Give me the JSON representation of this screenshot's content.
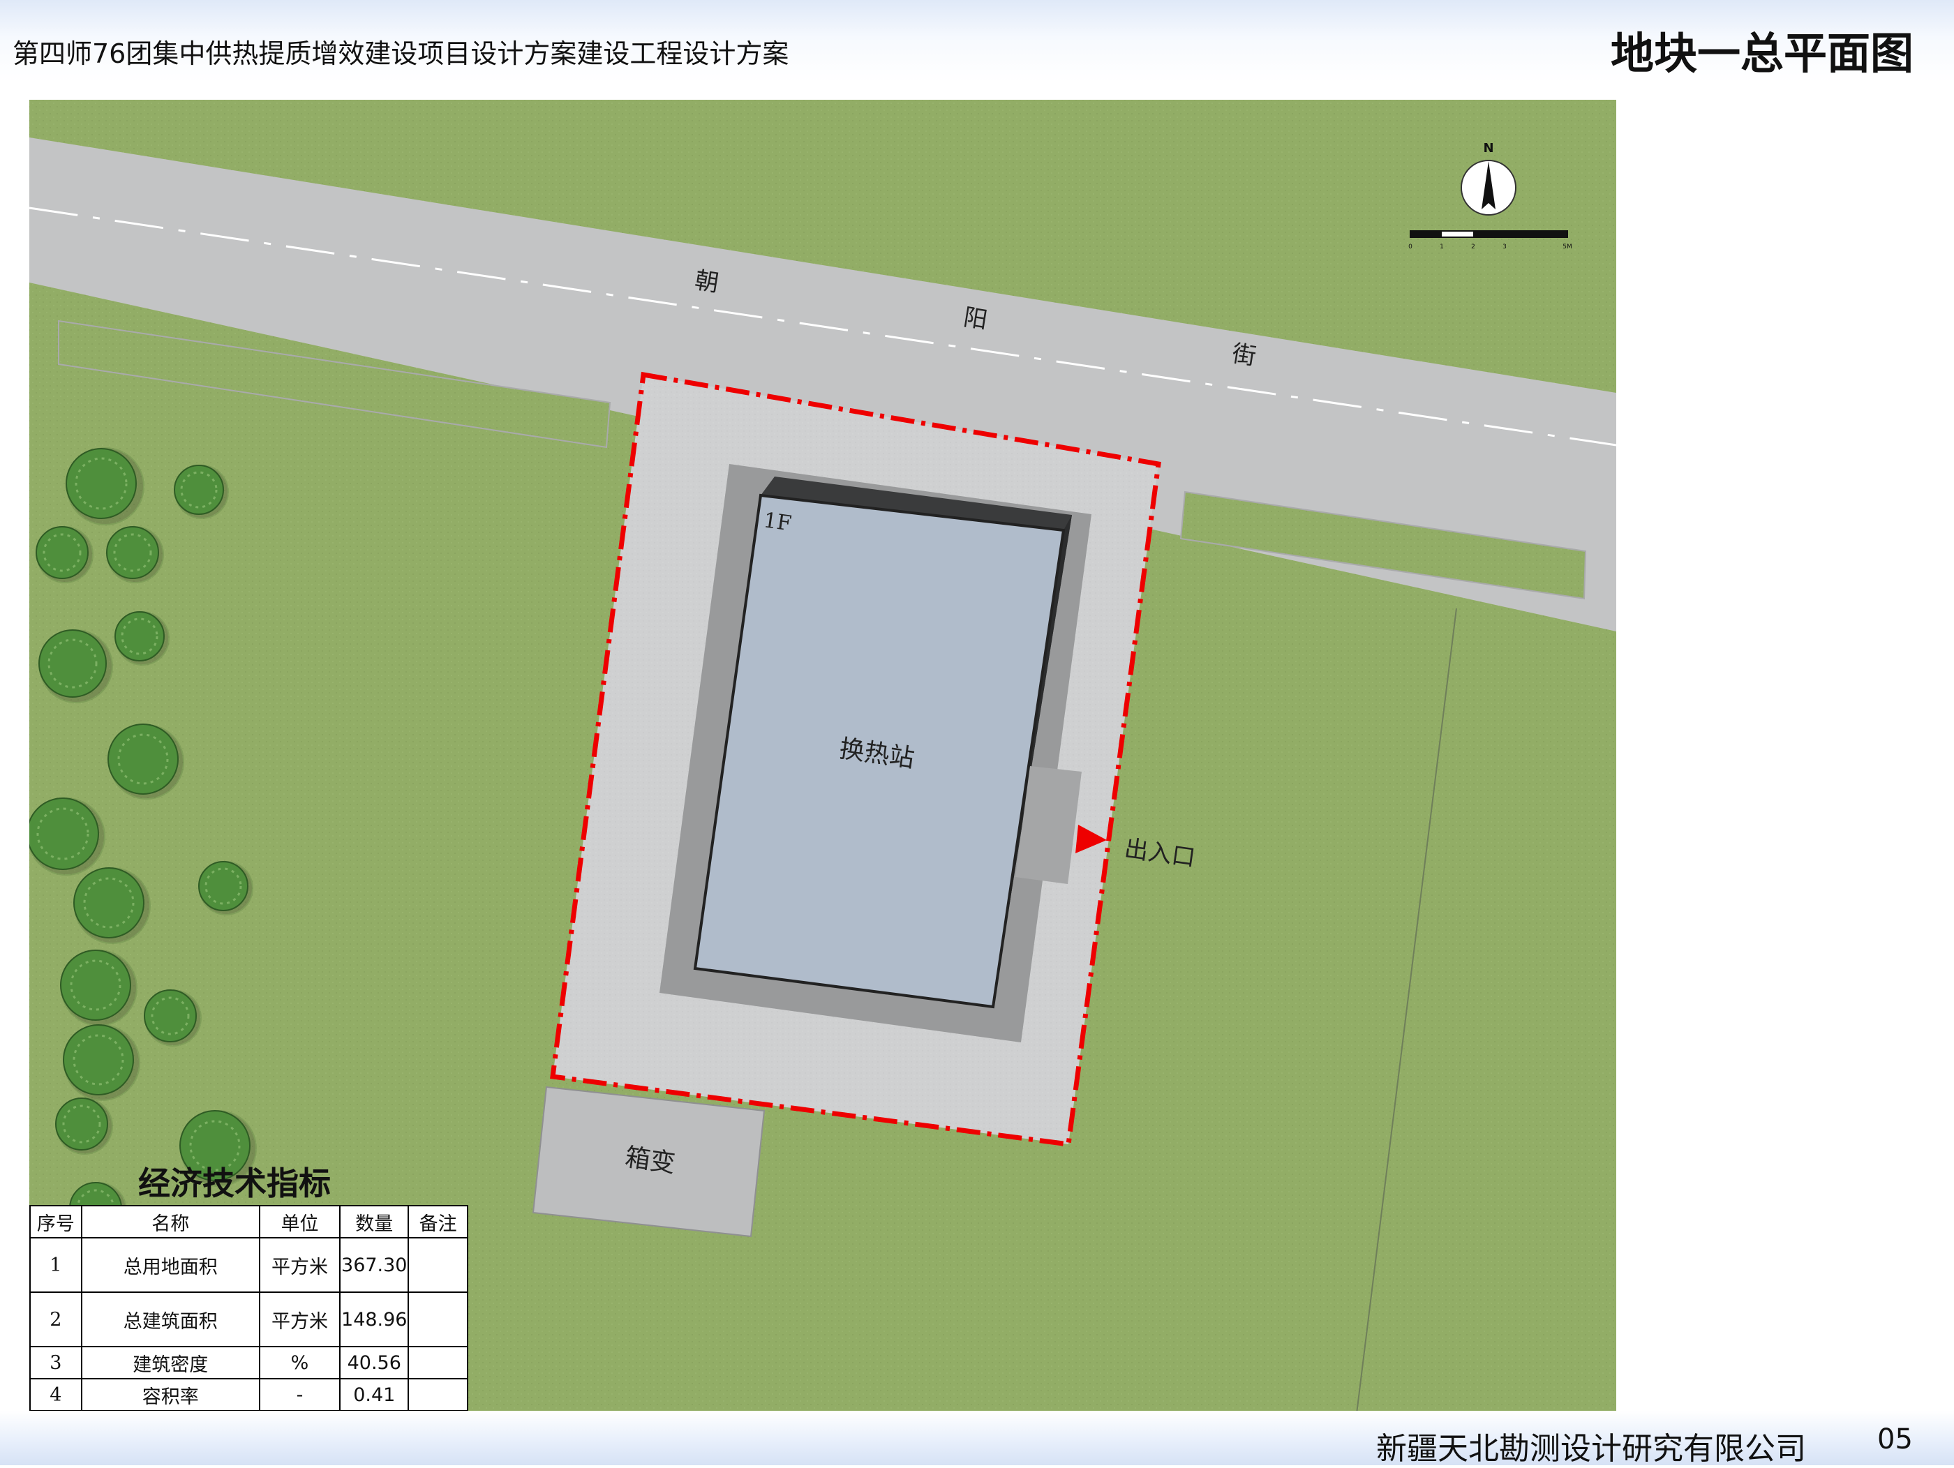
{
  "header": {
    "project_title": "第四师76团集中供热提质增效建设项目设计方案建设工程设计方案",
    "sheet_title": "地块一总平面图"
  },
  "site_plan": {
    "street_chars": [
      "朝",
      "阳",
      "街"
    ],
    "building_floor": "1F",
    "building_name": "换热站",
    "entrance_label": "出入口",
    "transformer_label": "箱变",
    "north_label": "N",
    "scale_labels": [
      "0",
      "1",
      "2",
      "3",
      "5M"
    ],
    "tree_icon": "tree-icon",
    "north_arrow_icon": "north-arrow-icon",
    "colors": {
      "grass": "#92ad66",
      "road": "#c3c4c5",
      "pavement": "#cfd0d1",
      "building_roof": "#b0bccb",
      "site_boundary": "#ee0000",
      "tree": "#4f8f3c"
    }
  },
  "indicators": {
    "title": "经济技术指标",
    "headers": [
      "序号",
      "名称",
      "单位",
      "数量",
      "备注"
    ],
    "rows": [
      {
        "no": "1",
        "name": "总用地面积",
        "unit": "平方米",
        "value": "367.30",
        "note": ""
      },
      {
        "no": "2",
        "name": "总建筑面积",
        "unit": "平方米",
        "value": "148.96",
        "note": ""
      },
      {
        "no": "3",
        "name": "建筑密度",
        "unit": "%",
        "value": "40.56",
        "note": ""
      },
      {
        "no": "4",
        "name": "容积率",
        "unit": "-",
        "value": "0.41",
        "note": ""
      }
    ]
  },
  "footer": {
    "company": "新疆天北勘测设计研究有限公司",
    "page_number": "05"
  }
}
